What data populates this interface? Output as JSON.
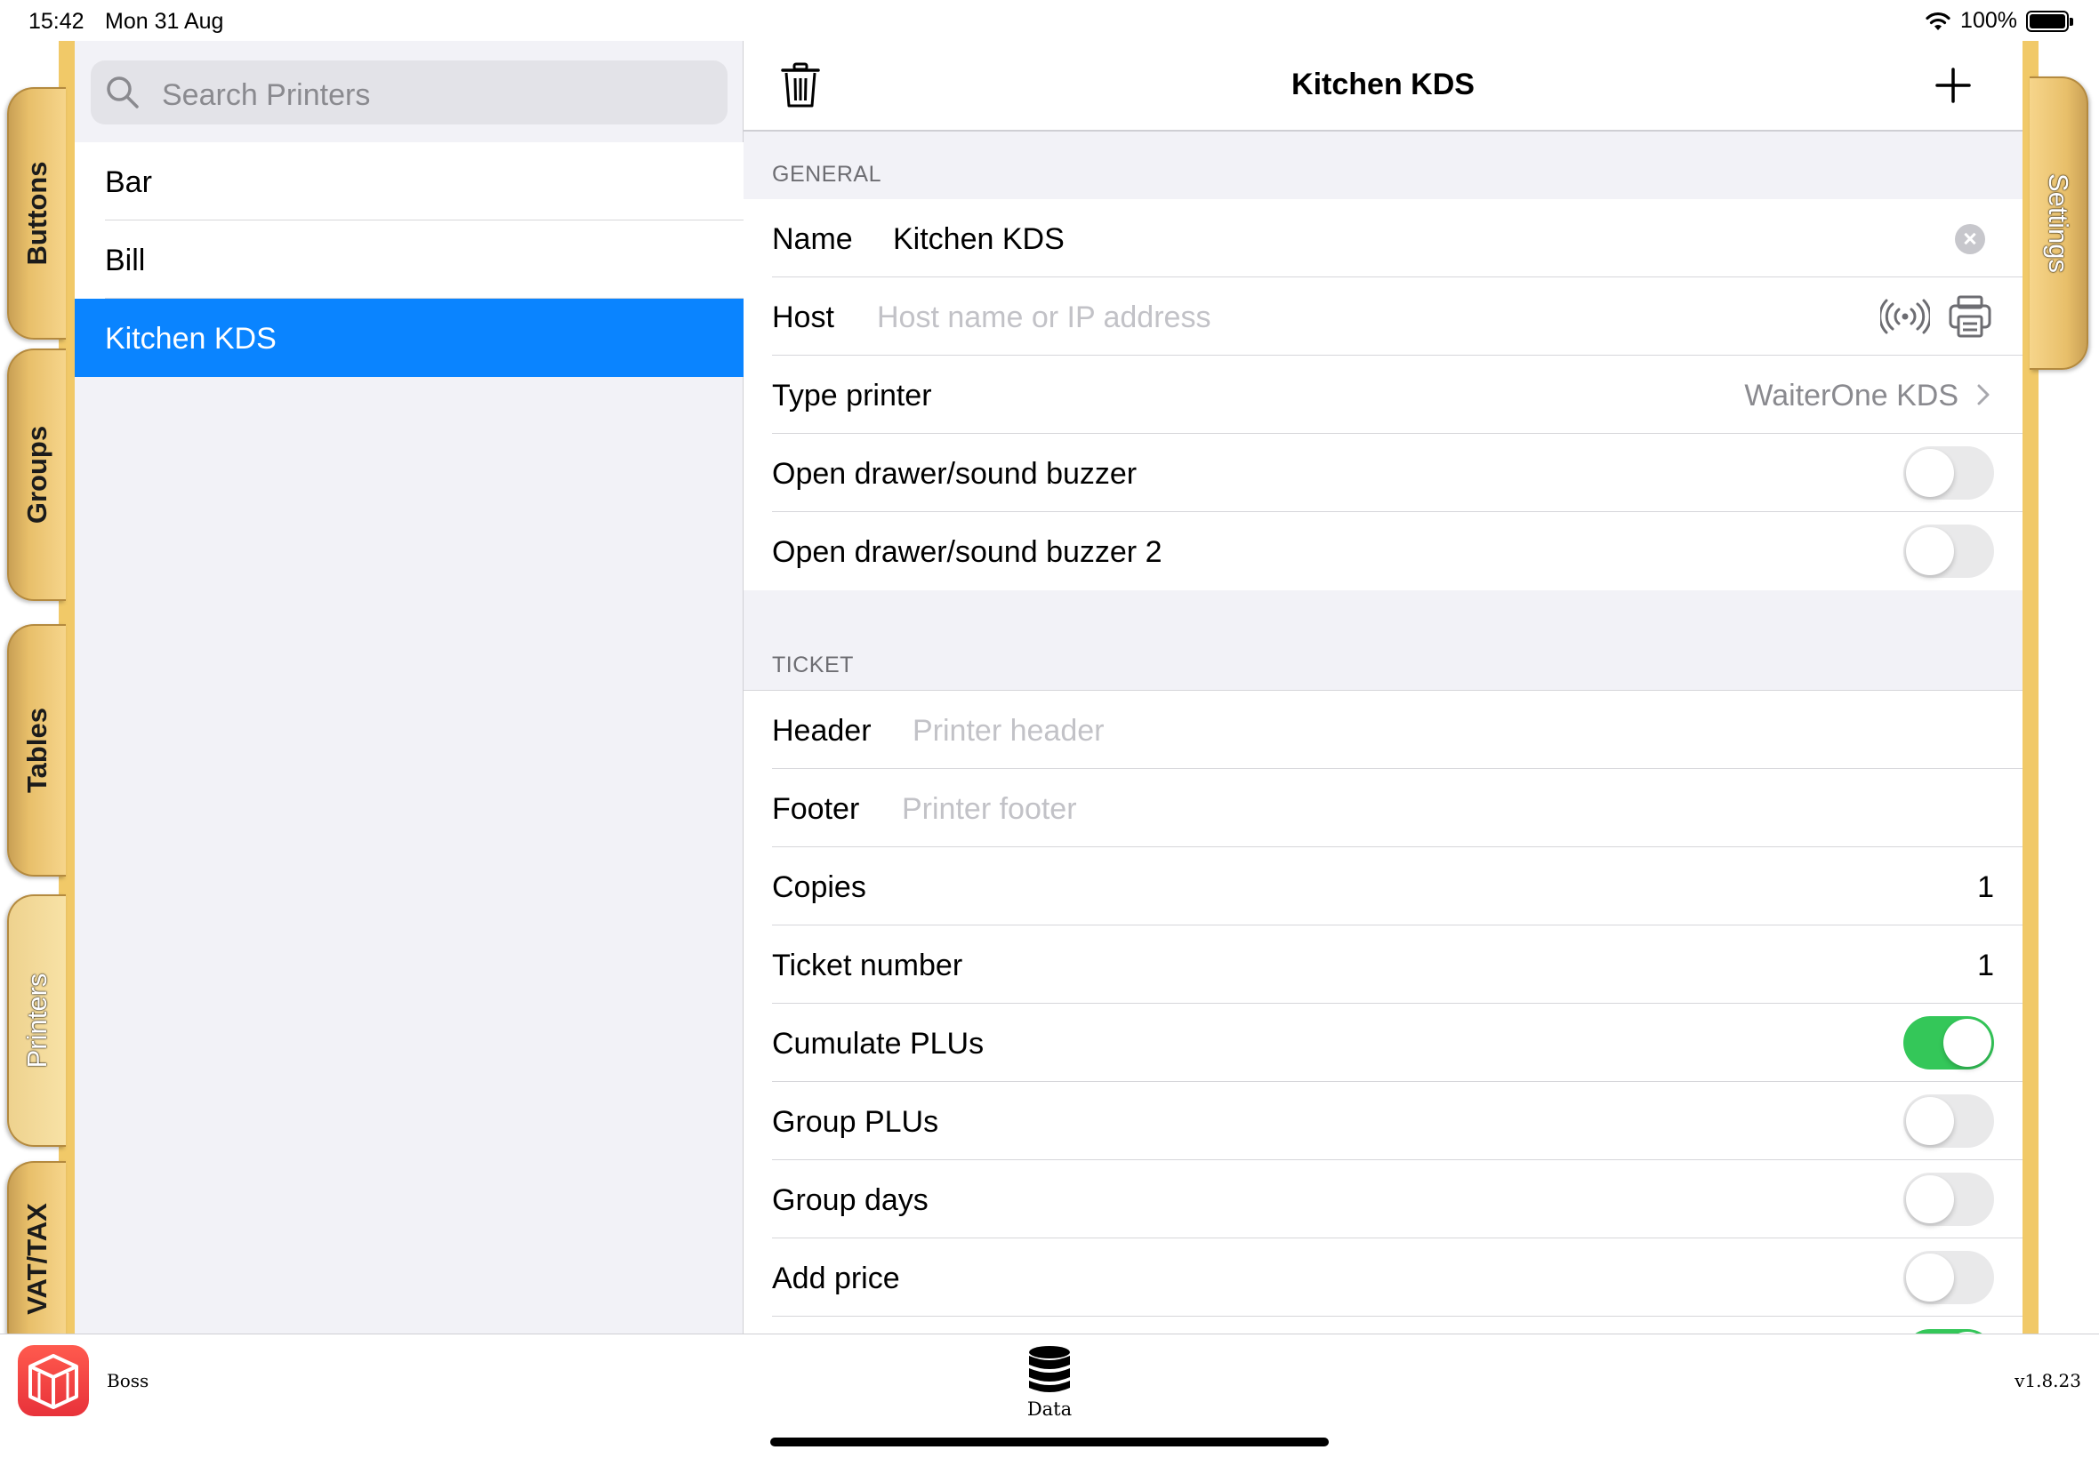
{
  "status_bar": {
    "time": "15:42",
    "date": "Mon 31 Aug",
    "battery": "100%"
  },
  "left_tabs": [
    {
      "label": "Buttons",
      "active": false
    },
    {
      "label": "Groups",
      "active": false
    },
    {
      "label": "Tables",
      "active": false
    },
    {
      "label": "Printers",
      "active": true
    },
    {
      "label": "VAT/TAX",
      "active": false
    }
  ],
  "right_tabs": [
    {
      "label": "Settings",
      "active": true
    }
  ],
  "search": {
    "placeholder": "Search Printers"
  },
  "printers": [
    {
      "name": "Bar",
      "selected": false
    },
    {
      "name": "Bill",
      "selected": false
    },
    {
      "name": "Kitchen KDS",
      "selected": true
    }
  ],
  "detail": {
    "title": "Kitchen KDS",
    "general": {
      "section_title": "GENERAL",
      "name_label": "Name",
      "name_value": "Kitchen KDS",
      "host_label": "Host",
      "host_placeholder": "Host name or IP address",
      "type_label": "Type printer",
      "type_value": "WaiterOne KDS",
      "drawer1_label": "Open drawer/sound buzzer",
      "drawer1_on": false,
      "drawer2_label": "Open drawer/sound buzzer 2",
      "drawer2_on": false
    },
    "ticket": {
      "section_title": "TICKET",
      "header_label": "Header",
      "header_placeholder": "Printer header",
      "footer_label": "Footer",
      "footer_placeholder": "Printer footer",
      "copies_label": "Copies",
      "copies_value": "1",
      "ticket_number_label": "Ticket number",
      "ticket_number_value": "1",
      "cumulate_label": "Cumulate PLUs",
      "cumulate_on": true,
      "group_plus_label": "Group PLUs",
      "group_plus_on": false,
      "group_days_label": "Group days",
      "group_days_on": false,
      "add_price_label": "Add price",
      "add_price_on": false
    }
  },
  "bottom_bar": {
    "app_name": "Boss",
    "data_label": "Data",
    "version": "v1.8.23"
  },
  "colors": {
    "selection": "#0a84ff",
    "toggle_on": "#34c759",
    "tab_gold": "#e8bf6a",
    "app_icon": "#e8323a"
  }
}
